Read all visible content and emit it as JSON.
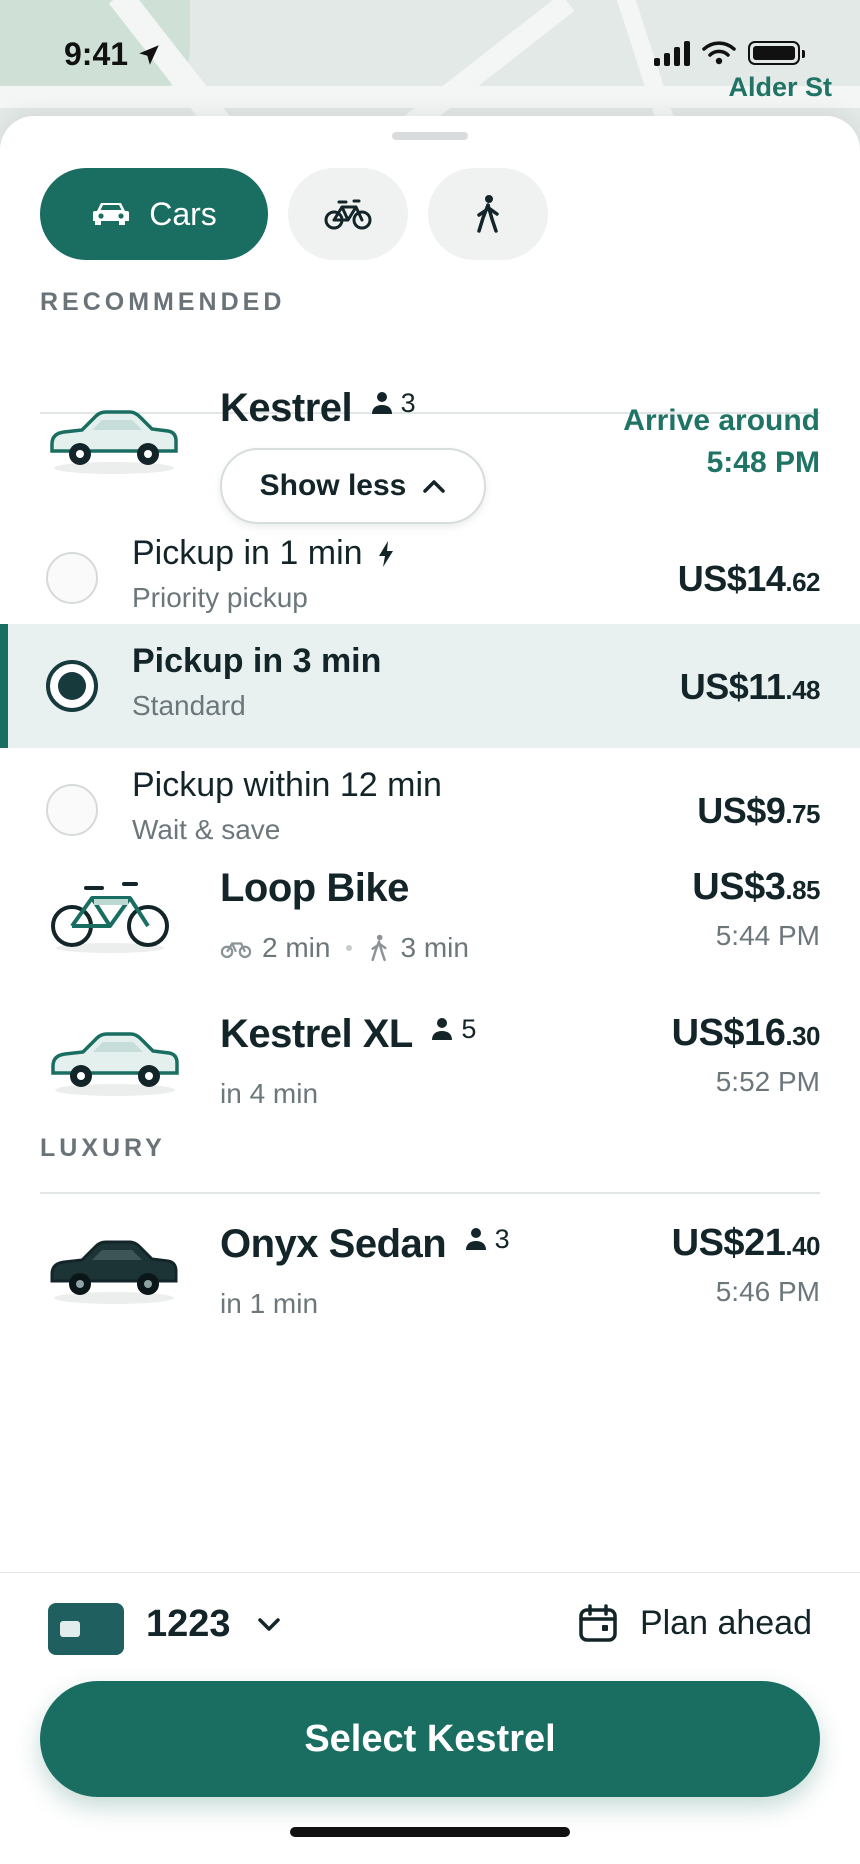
{
  "status": {
    "time": "9:41"
  },
  "map": {
    "street": "Alder St"
  },
  "modes": [
    {
      "label": "Cars",
      "icon": "car-icon",
      "active": true
    },
    {
      "label": "",
      "icon": "bike-icon",
      "active": false
    },
    {
      "label": "",
      "icon": "walk-icon",
      "active": false
    }
  ],
  "recommended": {
    "heading": "RECOMMENDED",
    "primary": {
      "name": "Kestrel",
      "capacity": "3",
      "toggle_label": "Show less",
      "arrive_line1": "Arrive around",
      "arrive_line2": "5:48 PM"
    },
    "options": [
      {
        "title": "Pickup in 1 min",
        "subtitle": "Priority pickup",
        "price_main": "US$14",
        "price_cents": ".62",
        "selected": false
      },
      {
        "title": "Pickup in 3 min",
        "subtitle": "Standard",
        "price_main": "US$11",
        "price_cents": ".48",
        "selected": true
      },
      {
        "title": "Pickup within 12 min",
        "subtitle": "Wait & save",
        "price_main": "US$9",
        "price_cents": ".75",
        "selected": false
      }
    ],
    "loop_bike": {
      "name": "Loop Bike",
      "bike_time": "2 min",
      "walk_time": "3 min",
      "price_main": "US$3",
      "price_cents": ".85",
      "eta": "5:44 PM"
    },
    "kestrel_xl": {
      "name": "Kestrel XL",
      "capacity": "5",
      "pickup": "in 4 min",
      "price_main": "US$16",
      "price_cents": ".30",
      "eta": "5:52 PM"
    }
  },
  "luxury": {
    "heading": "LUXURY",
    "onyx": {
      "name": "Onyx Sedan",
      "capacity": "3",
      "pickup": "in 1 min",
      "price_main": "US$21",
      "price_cents": ".40",
      "eta": "5:46 PM"
    }
  },
  "footer": {
    "card_number": "1223",
    "plan_label": "Plan ahead",
    "cta_label": "Select Kestrel"
  },
  "colors": {
    "accent": "#1a6e61",
    "selected_bg": "#e8f1f0",
    "text": "#132528",
    "muted": "#6c777b"
  }
}
